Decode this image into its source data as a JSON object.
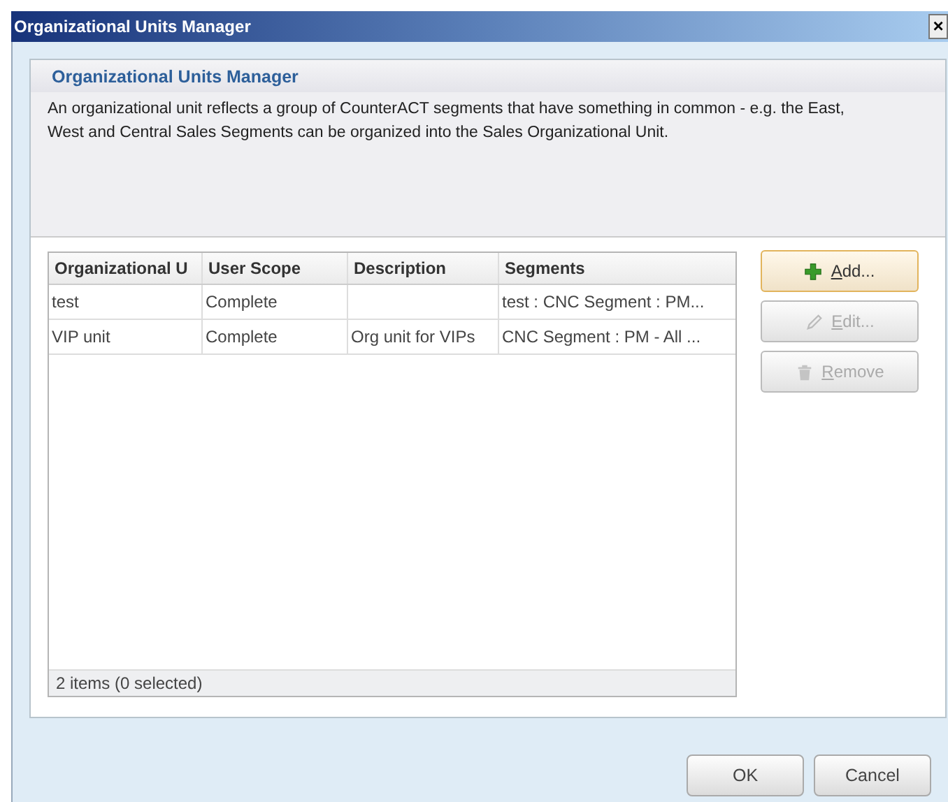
{
  "window": {
    "title": "Organizational Units Manager",
    "close": "×"
  },
  "panel": {
    "title": "Organizational Units Manager",
    "description": "An organizational unit reflects a group of CounterACT segments that have something in common - e.g. the East, West and Central Sales Segments can be organized into the Sales Organizational Unit."
  },
  "table": {
    "columns": [
      "Organizational U",
      "User Scope",
      "Description",
      "Segments"
    ],
    "rows": [
      [
        "test",
        "Complete",
        "",
        "test : CNC Segment : PM..."
      ],
      [
        "VIP unit",
        "Complete",
        "Org unit for VIPs",
        "CNC Segment : PM - All ..."
      ]
    ],
    "status": "2 items (0 selected)"
  },
  "actions": [
    {
      "label": "Add...",
      "kind": "add",
      "disabled": false
    },
    {
      "label": "Edit...",
      "kind": "edit",
      "disabled": true
    },
    {
      "label": "Remove",
      "kind": "remove",
      "disabled": true
    }
  ],
  "buttons": [
    "OK",
    "Cancel"
  ]
}
